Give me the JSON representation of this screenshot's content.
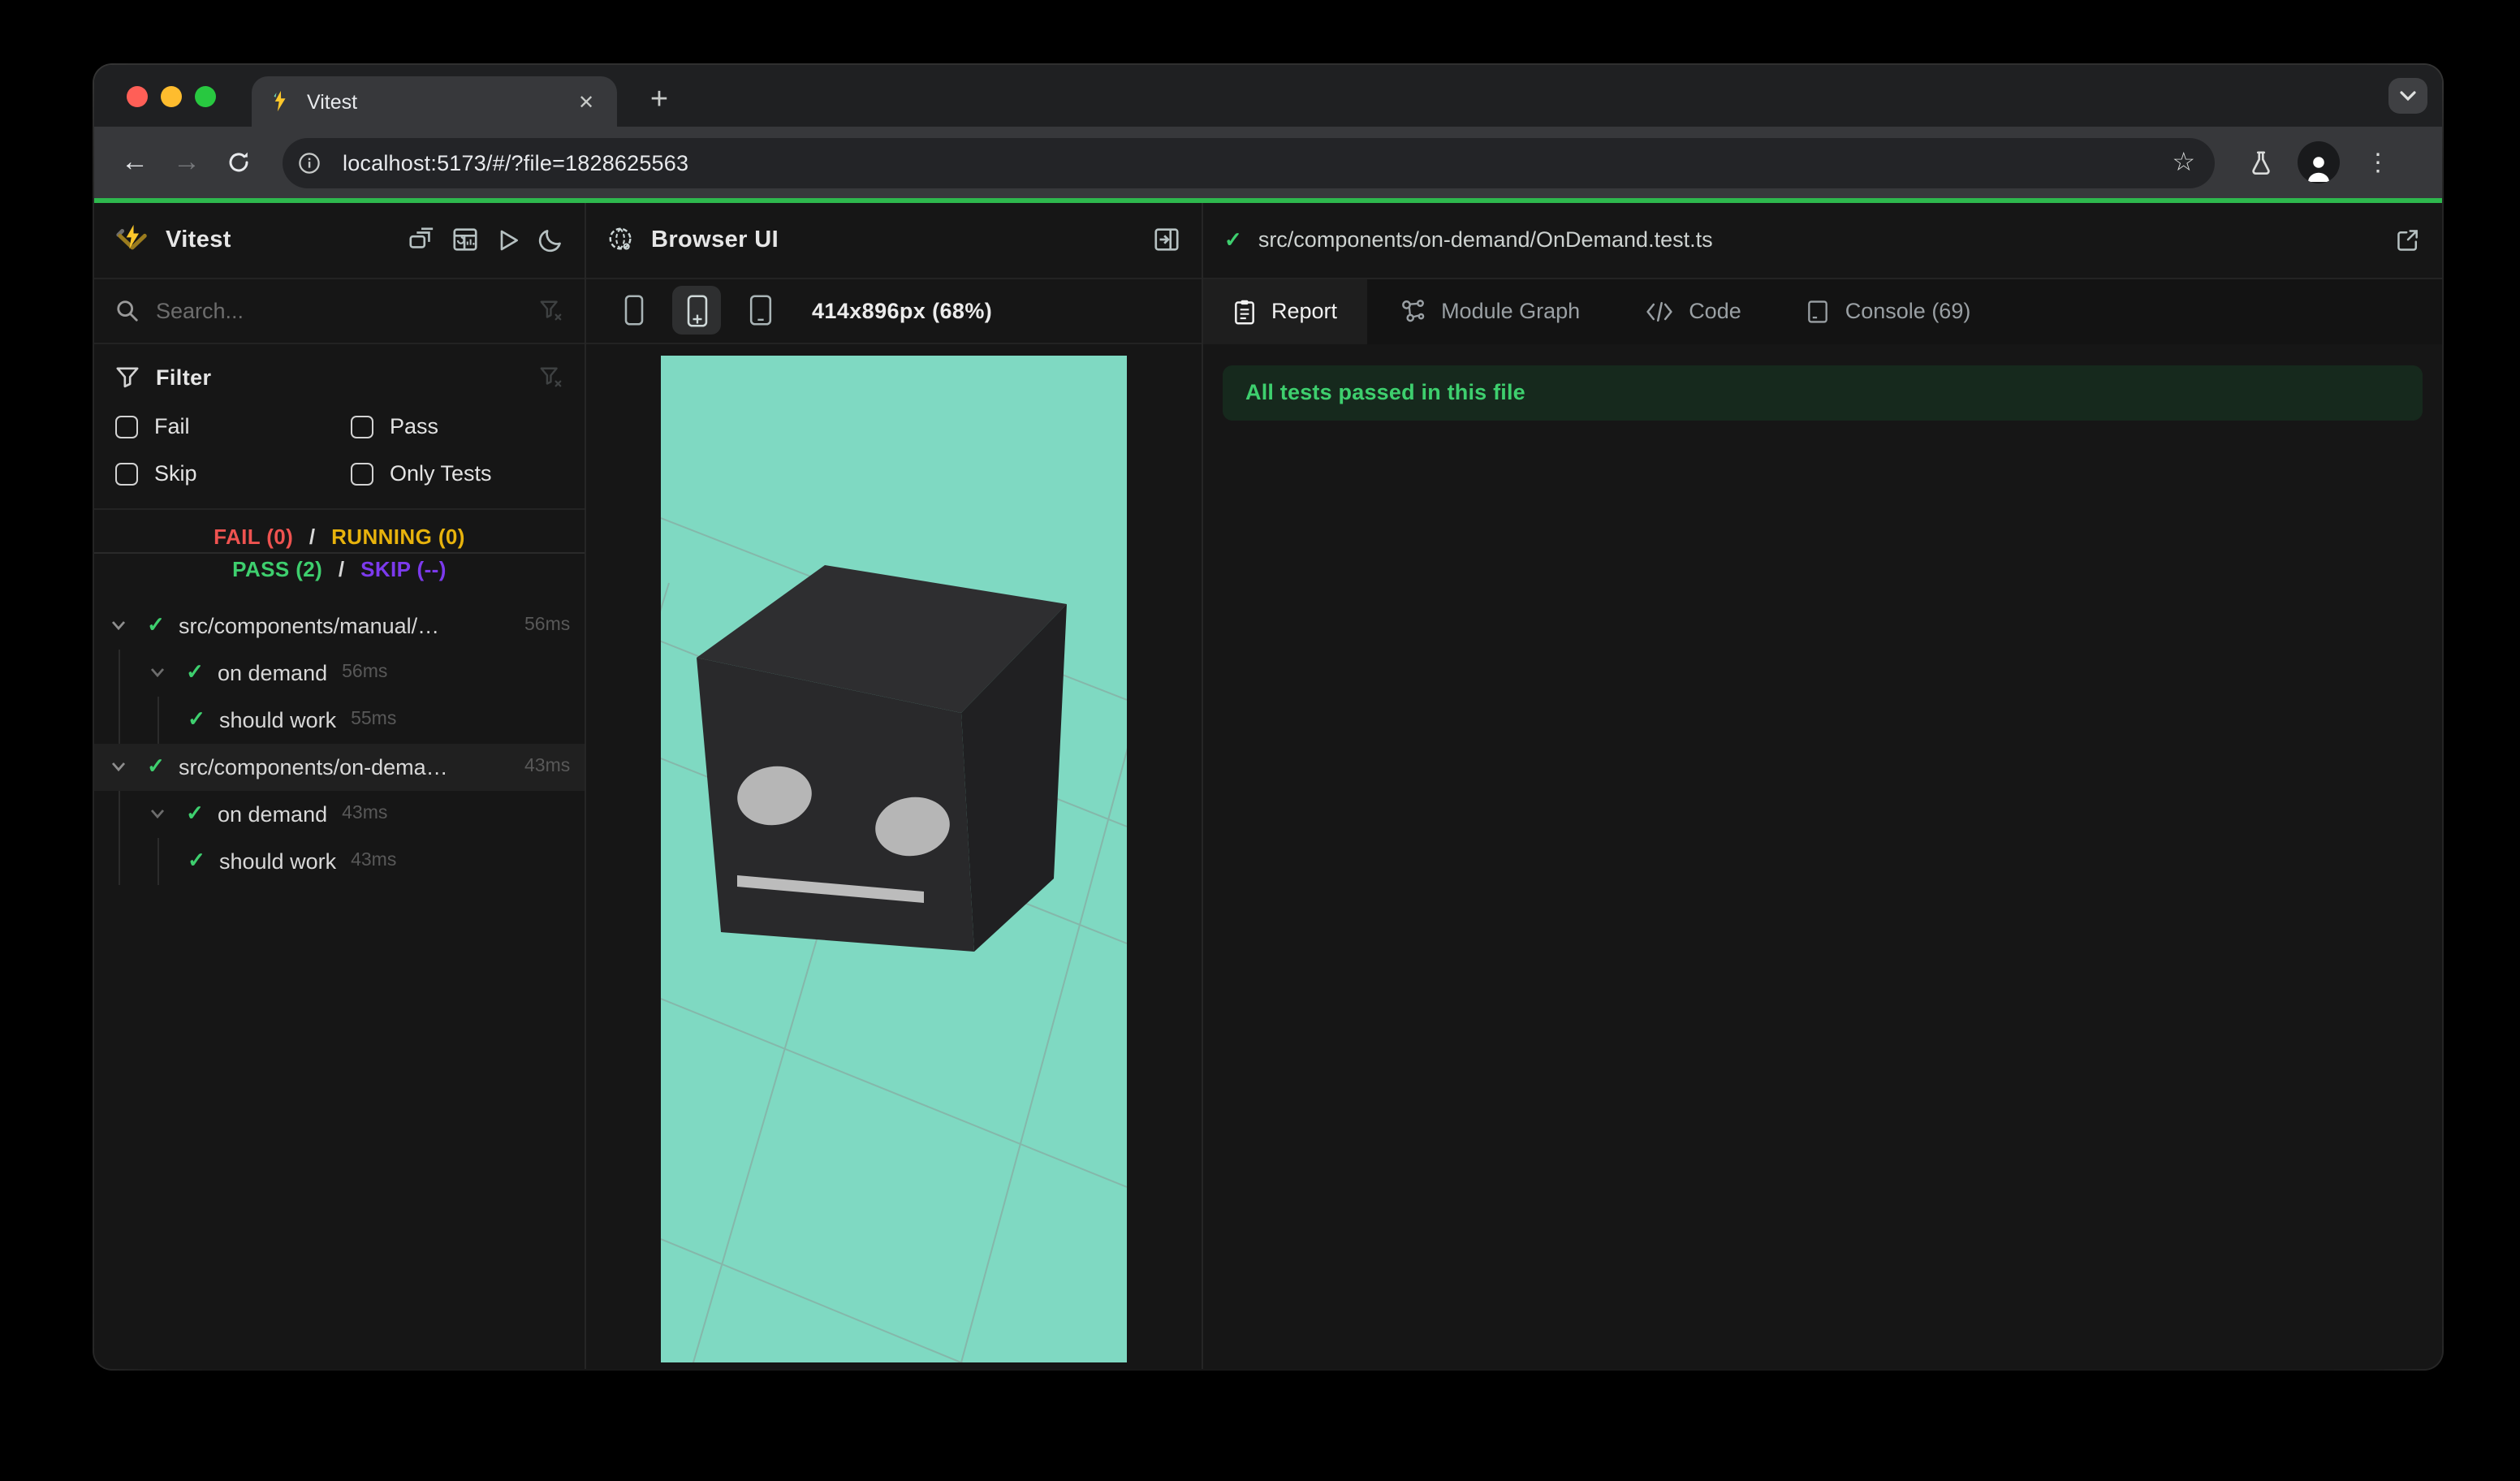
{
  "browser": {
    "tab_title": "Vitest",
    "url": "localhost:5173/#/?file=1828625563",
    "glyphs": {
      "close": "✕",
      "new_tab": "+",
      "back": "←",
      "forward": "→",
      "kebab": "⋮",
      "star": "☆"
    }
  },
  "icons": {
    "check": "✓"
  },
  "sidebar": {
    "app_name": "Vitest",
    "search": {
      "placeholder": "Search...",
      "value": ""
    },
    "filter": {
      "title": "Filter",
      "options": [
        {
          "label": "Fail",
          "checked": false
        },
        {
          "label": "Pass",
          "checked": false
        },
        {
          "label": "Skip",
          "checked": false
        },
        {
          "label": "Only Tests",
          "checked": false
        }
      ]
    },
    "summary": {
      "fail": "FAIL (0)",
      "running": "RUNNING (0)",
      "pass": "PASS (2)",
      "skip": "SKIP (--)",
      "separator": "/"
    },
    "tree": [
      {
        "label": "src/components/manual/…",
        "time": "56ms",
        "level": 1,
        "status": "pass"
      },
      {
        "label": "on demand",
        "time": "56ms",
        "level": 2,
        "status": "pass"
      },
      {
        "label": "should work",
        "time": "55ms",
        "level": 3,
        "status": "pass"
      },
      {
        "label": "src/components/on-dema…",
        "time": "43ms",
        "level": 1,
        "status": "pass",
        "selected": true
      },
      {
        "label": "on demand",
        "time": "43ms",
        "level": 2,
        "status": "pass"
      },
      {
        "label": "should work",
        "time": "43ms",
        "level": 3,
        "status": "pass"
      }
    ]
  },
  "preview": {
    "title": "Browser UI",
    "viewport_label": "414x896px (68%)"
  },
  "results": {
    "file_path": "src/components/on-demand/OnDemand.test.ts",
    "tabs": [
      {
        "label": "Report",
        "active": true
      },
      {
        "label": "Module Graph",
        "active": false
      },
      {
        "label": "Code",
        "active": false
      },
      {
        "label": "Console (69)",
        "active": false
      }
    ],
    "banner": "All tests passed in this file"
  },
  "colors": {
    "pass_green": "#3ecf6e",
    "fail_red": "#ef5350",
    "running_yellow": "#e8b30c",
    "skip_purple": "#7c3aed",
    "progress_bar_green": "#2eb84e",
    "canvas_teal": "#7fd9c2",
    "banner_bg": "#16291d",
    "cube_top": "#2e2e30",
    "cube_front": "#29292b",
    "cube_side": "#202022",
    "cube_face_gray": "#b8b8b8"
  }
}
